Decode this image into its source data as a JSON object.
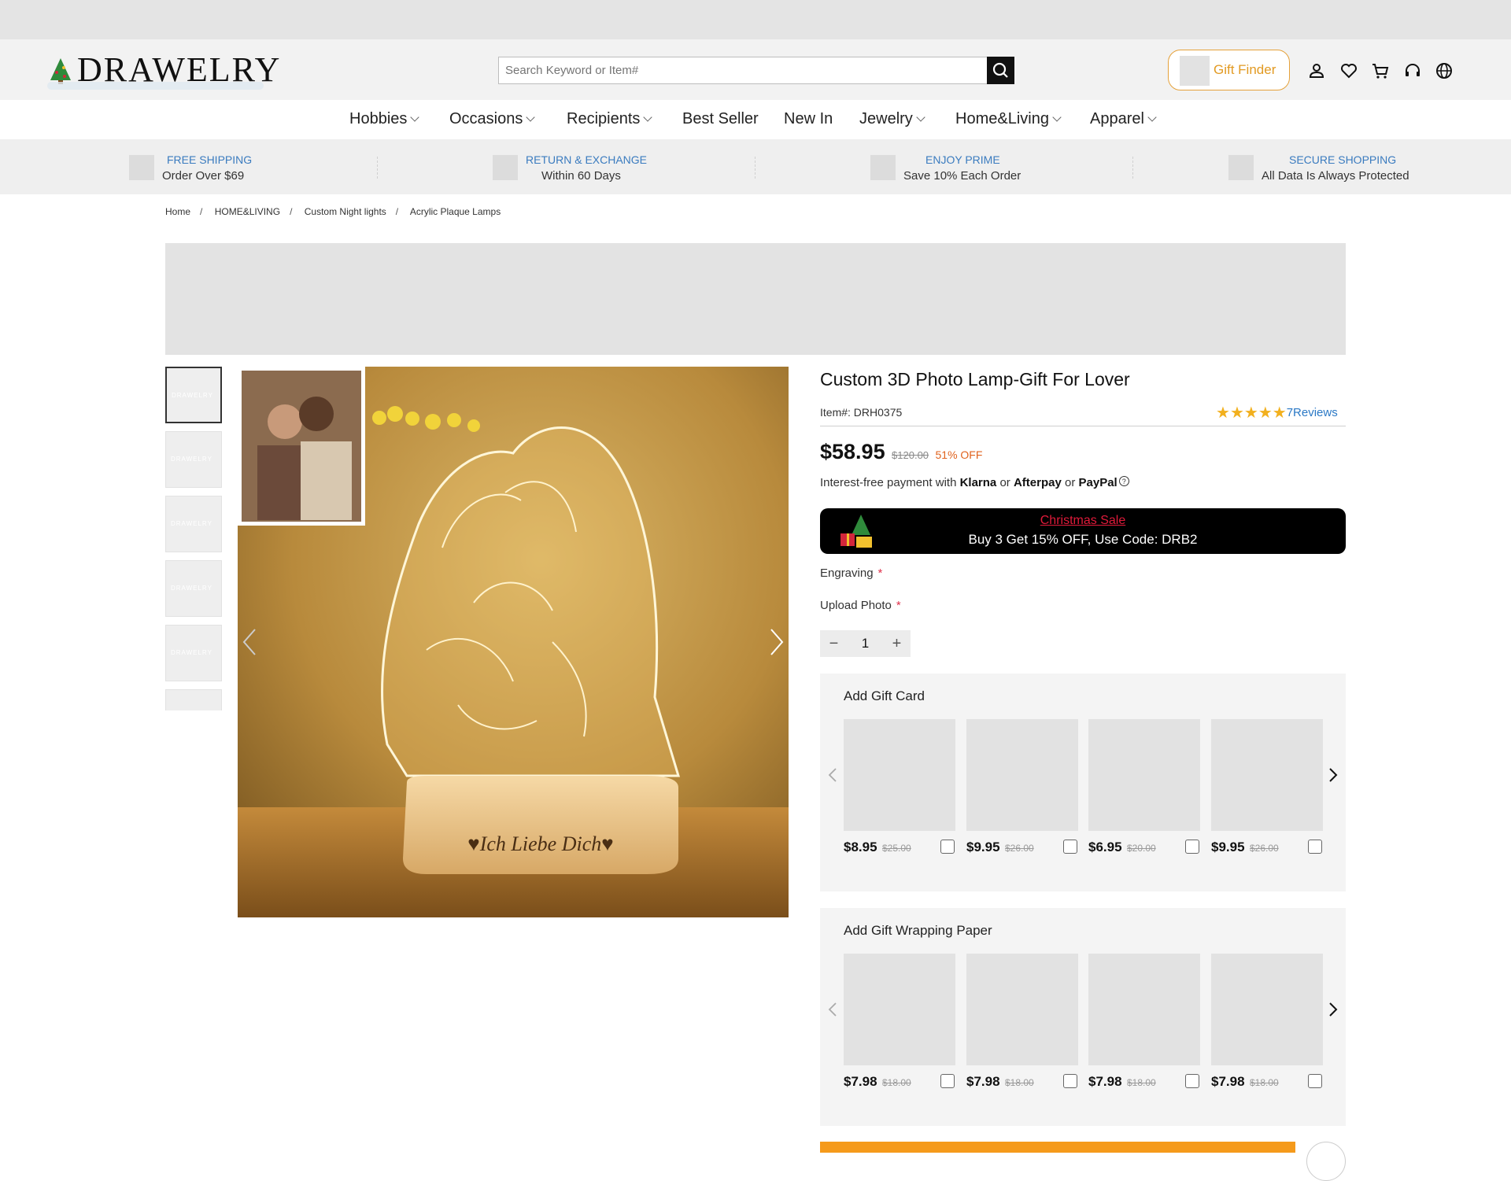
{
  "brand": {
    "logo_text": "DRAWELRY"
  },
  "search": {
    "placeholder": "Search Keyword or Item#"
  },
  "header": {
    "gift_finder_label": "Gift Finder"
  },
  "nav": {
    "items": [
      {
        "label": "Hobbies",
        "dropdown": true
      },
      {
        "label": "Occasions",
        "dropdown": true
      },
      {
        "label": "Recipients",
        "dropdown": true
      },
      {
        "label": "Best Seller",
        "dropdown": false
      },
      {
        "label": "New In",
        "dropdown": false
      },
      {
        "label": "Jewelry",
        "dropdown": true
      },
      {
        "label": "Home&Living",
        "dropdown": true
      },
      {
        "label": "Apparel",
        "dropdown": true
      }
    ]
  },
  "benefits": [
    {
      "title": "FREE SHIPPING",
      "subtitle": "Order Over $69"
    },
    {
      "title": "RETURN & EXCHANGE",
      "subtitle": "Within 60 Days"
    },
    {
      "title": "ENJOY PRIME",
      "subtitle": "Save 10% Each Order"
    },
    {
      "title": "SECURE SHOPPING",
      "subtitle": "All Data Is Always Protected"
    }
  ],
  "breadcrumb": [
    "Home",
    "HOME&LIVING",
    "Custom Night lights",
    "Acrylic Plaque Lamps"
  ],
  "product": {
    "title": "Custom 3D Photo Lamp-Gift For Lover",
    "item_number": "Item#: DRH0375",
    "rating": 5,
    "reviews": "7Reviews",
    "price": "$58.95",
    "original_price": "$120.00",
    "discount": "51% OFF",
    "engraving_text": "♥Ich Liebe Dich♥",
    "payment": {
      "prefix": "Interest-free payment with",
      "klarna": "Klarna",
      "or1": "or",
      "afterpay": "Afterpay",
      "or2": "or",
      "paypal": "PayPal"
    }
  },
  "promo": {
    "title": "Christmas Sale",
    "text": "Buy 3 Get 15% OFF, Use Code: DRB2"
  },
  "form": {
    "engraving_label": "Engraving",
    "upload_label": "Upload Photo",
    "required_mark": "*",
    "quantity": "1",
    "minus": "−",
    "plus": "+"
  },
  "gift_card": {
    "title": "Add Gift Card",
    "items": [
      {
        "price": "$8.95",
        "old": "$25.00"
      },
      {
        "price": "$9.95",
        "old": "$26.00"
      },
      {
        "price": "$6.95",
        "old": "$20.00"
      },
      {
        "price": "$9.95",
        "old": "$26.00"
      }
    ]
  },
  "gift_wrap": {
    "title": "Add Gift Wrapping Paper",
    "items": [
      {
        "price": "$7.98",
        "old": "$18.00"
      },
      {
        "price": "$7.98",
        "old": "$18.00"
      },
      {
        "price": "$7.98",
        "old": "$18.00"
      },
      {
        "price": "$7.98",
        "old": "$18.00"
      }
    ]
  },
  "icons": {
    "search": "search-icon",
    "account": "user-icon",
    "wishlist": "heart-icon",
    "cart": "cart-icon",
    "support": "headset-icon",
    "language": "globe-icon"
  },
  "colors": {
    "accent_orange": "#e29a22",
    "link_blue": "#3a7bbf",
    "promo_red": "#e01a3a",
    "star": "#f2b01e",
    "cart_orange": "#f59a1b"
  }
}
